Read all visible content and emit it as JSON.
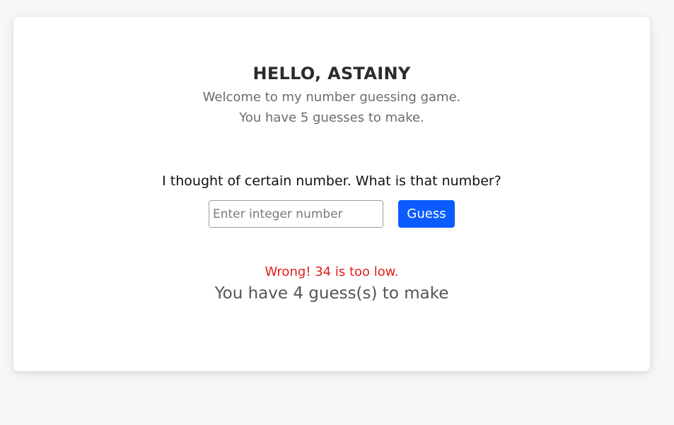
{
  "header": {
    "greeting": "HELLO, ASTAINY",
    "welcome": "Welcome to my number guessing game.",
    "guesses_info": "You have 5 guesses to make."
  },
  "game": {
    "question": "I thought of certain number. What is that number?",
    "input_placeholder": "Enter integer number",
    "input_value": "",
    "guess_label": "Guess",
    "feedback": "Wrong! 34 is too low.",
    "remaining": "You have 4 guess(s) to make"
  },
  "colors": {
    "accent": "#0b5cff",
    "error": "#e11d1d",
    "background": "#f7f7f7"
  }
}
